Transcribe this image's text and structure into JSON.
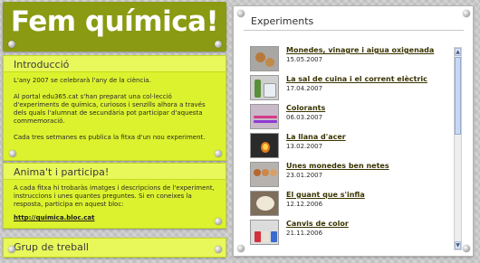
{
  "header": {
    "title": "Fem química!"
  },
  "introduccio": {
    "title": "Introducció",
    "paragraphs": [
      "L'any 2007 se celebrarà l'any de la ciència.",
      "Al portal edu365.cat s'han preparat una col·lecció d'experiments de química, curiosos i senzills alhora a través dels quals l'alumnat de secundària pot participar d'aquesta commemoració.",
      "Cada tres setmanes es publica la fitxa d'un nou experiment."
    ]
  },
  "participa": {
    "title": "Anima't i participa!",
    "text": "A cada fitxa hi trobaràs imatges i descripcions de l'experiment, instruccions i unes quantes preguntes. Si en coneixes la resposta, participa en aquest bloc:",
    "link": "http://quimica.bloc.cat"
  },
  "grup": {
    "title": "Grup de treball"
  },
  "experiments": {
    "title": "Experiments",
    "items": [
      {
        "name": "Monedes, vinagre i aigua oxigenada",
        "date": "15.05.2007",
        "icon": "coins-thumbnail"
      },
      {
        "name": "La sal de cuina i el corrent elèctric",
        "date": "17.04.2007",
        "icon": "glassware-thumbnail"
      },
      {
        "name": "Colorants",
        "date": "06.03.2007",
        "icon": "test-tubes-thumbnail"
      },
      {
        "name": "La llana d'acer",
        "date": "13.02.2007",
        "icon": "flame-thumbnail"
      },
      {
        "name": "Unes monedes ben netes",
        "date": "23.01.2007",
        "icon": "coins-thumbnail"
      },
      {
        "name": "El guant que s'infla",
        "date": "12.12.2006",
        "icon": "glove-thumbnail"
      },
      {
        "name": "Canvis de color",
        "date": "21.11.2006",
        "icon": "colors-thumbnail"
      }
    ]
  },
  "colors": {
    "header": "#8a9a12",
    "panel": "#dcf22e",
    "background": "#c9c9c9"
  }
}
